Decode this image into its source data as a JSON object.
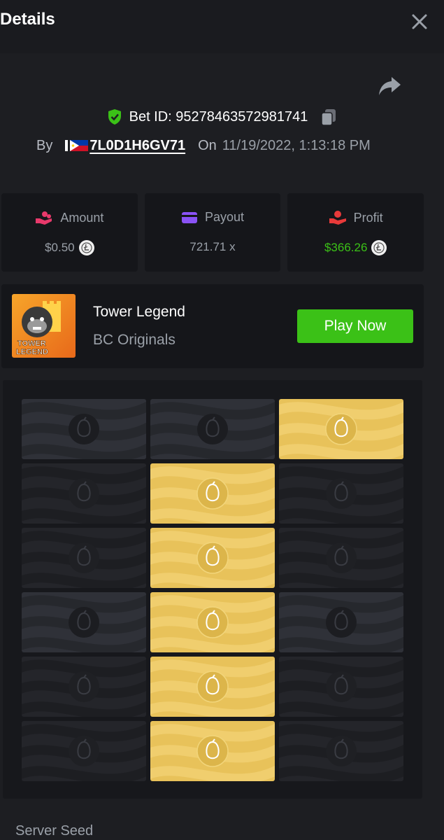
{
  "header": {
    "title": "Details"
  },
  "bet": {
    "id_text": "Bet ID: 95278463572981741",
    "by_label": "By",
    "username": "7L0D1H6GV71",
    "on_label": "On",
    "date": "11/19/2022, 1:13:18 PM"
  },
  "stats": [
    {
      "label": "Amount",
      "value": "$0.50",
      "icon": "coins-hand-icon",
      "color": "#e8396b"
    },
    {
      "label": "Payout",
      "value": "721.71 x",
      "icon": "card-icon",
      "color": "#8a52f5"
    },
    {
      "label": "Profit",
      "value": "$366.26",
      "icon": "profit-hand-icon",
      "color": "#e83a3a"
    }
  ],
  "game": {
    "title": "Tower Legend",
    "provider": "BC Originals",
    "play_label": "Play Now",
    "thumb_text": "TOWER LEGEND"
  },
  "board": {
    "columns": 3,
    "rows": [
      [
        "gray",
        "gray",
        "gold"
      ],
      [
        "dark",
        "gold",
        "dark"
      ],
      [
        "dark",
        "gold",
        "dark"
      ],
      [
        "gray",
        "gold",
        "gray"
      ],
      [
        "dark",
        "gold",
        "dark"
      ],
      [
        "dark",
        "gold",
        "dark"
      ]
    ]
  },
  "footer": {
    "seed_label": "Server Seed"
  },
  "colors": {
    "accent_green": "#3bc117",
    "gold": "#e8c25a",
    "bg": "#1d1e22"
  }
}
